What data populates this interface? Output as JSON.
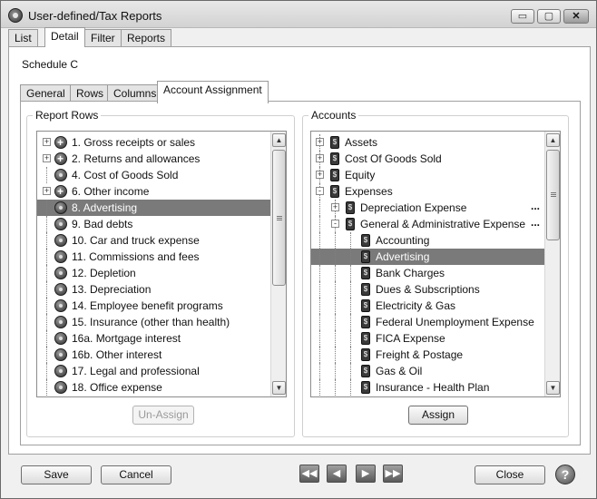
{
  "window": {
    "title": "User-defined/Tax Reports"
  },
  "title_buttons": {
    "minimize": "▭",
    "maximize": "▢",
    "close": "✕"
  },
  "main_tabs": [
    {
      "label": "List"
    },
    {
      "label": "Detail"
    },
    {
      "label": "Filter"
    },
    {
      "label": "Reports"
    }
  ],
  "detail": {
    "schedule_label": "Schedule C"
  },
  "sub_tabs": [
    {
      "label": "General"
    },
    {
      "label": "Rows"
    },
    {
      "label": "Columns"
    },
    {
      "label": "Account Assignment"
    }
  ],
  "report_rows": {
    "title": "Report Rows",
    "items": [
      {
        "label": "1.  Gross receipts or sales"
      },
      {
        "label": "2.  Returns and allowances"
      },
      {
        "label": "4.  Cost of Goods Sold"
      },
      {
        "label": "6.  Other income"
      },
      {
        "label": "8.  Advertising"
      },
      {
        "label": "9.  Bad debts"
      },
      {
        "label": "10.  Car and truck expense"
      },
      {
        "label": "11.  Commissions and fees"
      },
      {
        "label": "12.  Depletion"
      },
      {
        "label": "13.  Depreciation"
      },
      {
        "label": "14.  Employee benefit programs"
      },
      {
        "label": "15.  Insurance (other than health)"
      },
      {
        "label": "16a. Mortgage interest"
      },
      {
        "label": "16b. Other interest"
      },
      {
        "label": "17.  Legal and professional"
      },
      {
        "label": "18.  Office expense"
      }
    ],
    "unassign_label": "Un-Assign"
  },
  "accounts": {
    "title": "Accounts",
    "items": [
      {
        "label": "Assets"
      },
      {
        "label": "Cost Of Goods Sold"
      },
      {
        "label": "Equity"
      },
      {
        "label": "Expenses"
      },
      {
        "label": "Depreciation Expense"
      },
      {
        "label": "General & Administrative Expense"
      },
      {
        "label": "Accounting"
      },
      {
        "label": "Advertising"
      },
      {
        "label": "Bank Charges"
      },
      {
        "label": "Dues & Subscriptions"
      },
      {
        "label": "Electricity & Gas"
      },
      {
        "label": "Federal Unemployment Expense"
      },
      {
        "label": "FICA Expense"
      },
      {
        "label": "Freight & Postage"
      },
      {
        "label": "Gas & Oil"
      },
      {
        "label": "Insurance - Health Plan"
      }
    ],
    "ellipsis": "...",
    "assign_label": "Assign"
  },
  "footer": {
    "save_label": "Save",
    "cancel_label": "Cancel",
    "close_label": "Close",
    "nav_first": "◀◀",
    "nav_prev": "◀",
    "nav_next": "▶",
    "nav_last": "▶▶",
    "help": "?"
  }
}
